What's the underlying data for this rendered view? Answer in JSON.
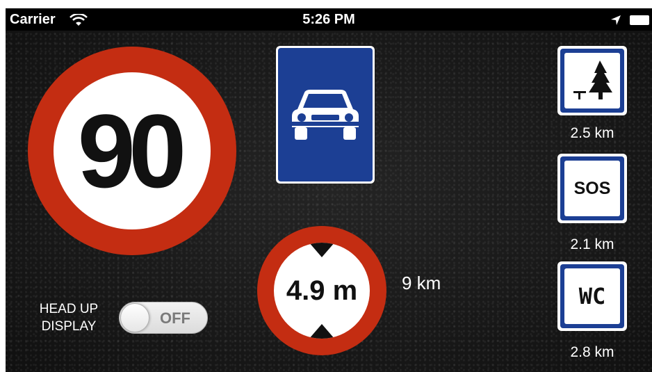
{
  "status_bar": {
    "carrier": "Carrier",
    "time": "5:26 PM",
    "icons": [
      "wifi-icon",
      "location-arrow-icon",
      "battery-icon"
    ]
  },
  "speed_limit": {
    "value": "90",
    "ring_color": "#c42d12"
  },
  "road_type": {
    "icon": "car-icon",
    "color": "#1c3f94"
  },
  "height_limit": {
    "value": "4.9 m",
    "distance": "9 km"
  },
  "services": [
    {
      "icon": "picnic-area-icon",
      "distance": "2.5 km"
    },
    {
      "label": "SOS",
      "distance": "2.1 km"
    },
    {
      "label": "WC",
      "distance": "2.8 km"
    }
  ],
  "head_up_display": {
    "label_line1": "HEAD UP",
    "label_line2": "DISPLAY",
    "state": "OFF",
    "enabled": false
  }
}
